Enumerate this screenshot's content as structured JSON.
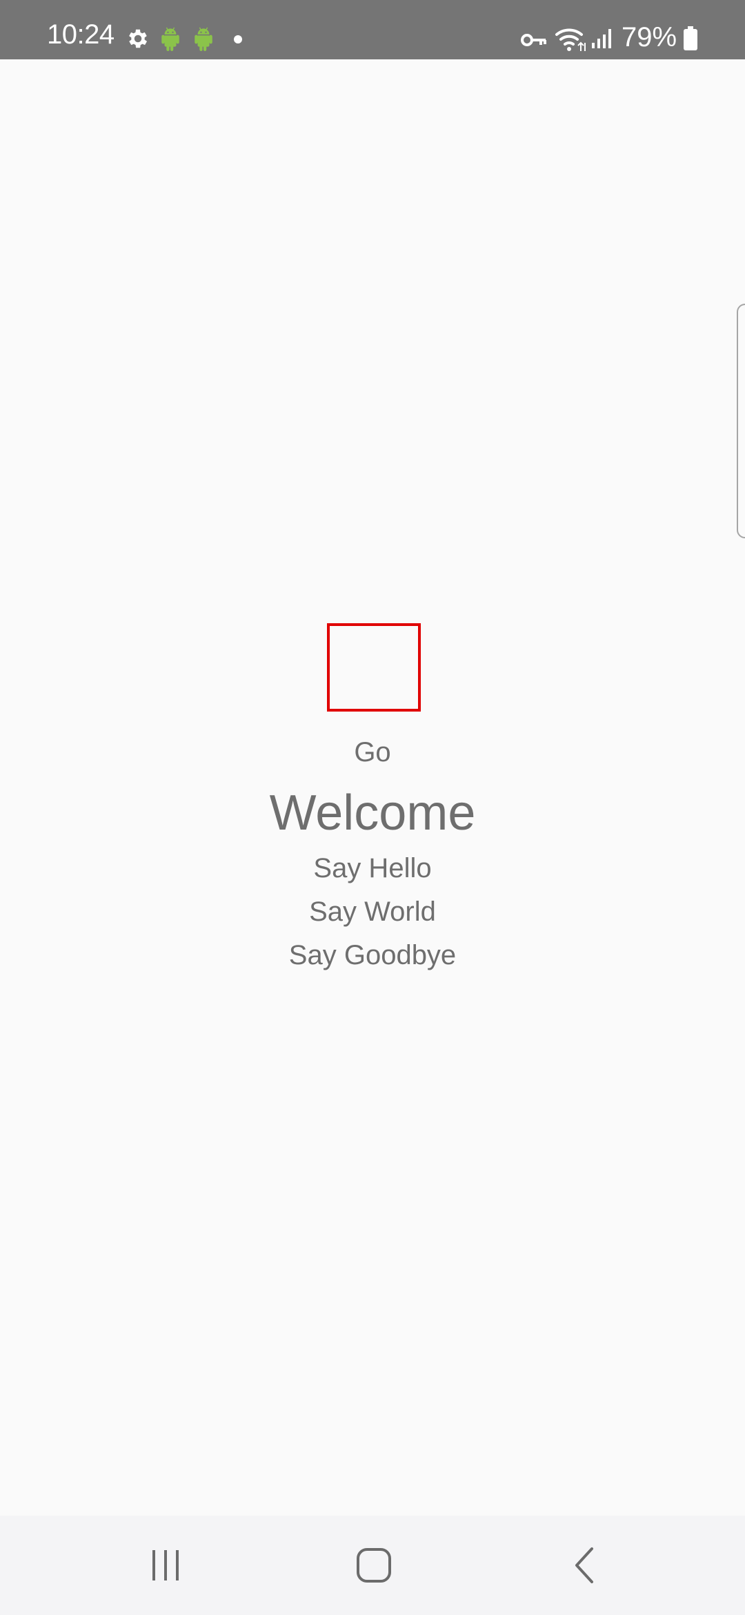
{
  "status_bar": {
    "time": "10:24",
    "battery_percent": "79%",
    "icons": [
      "settings-gear-icon",
      "android-icon",
      "android-icon",
      "notification-dot-icon",
      "vpn-key-icon",
      "wifi-icon",
      "signal-icon",
      "battery-icon"
    ],
    "android_icon_color": "#8bc34a"
  },
  "main": {
    "go_label": "Go",
    "welcome_label": "Welcome",
    "say_hello_label": "Say Hello",
    "say_world_label": "Say World",
    "say_goodbye_label": "Say Goodbye",
    "highlight_color": "#e00000",
    "text_color": "#6e6e6e"
  },
  "nav_bar": {
    "buttons": [
      "recent-apps-icon",
      "home-icon",
      "back-icon"
    ]
  }
}
